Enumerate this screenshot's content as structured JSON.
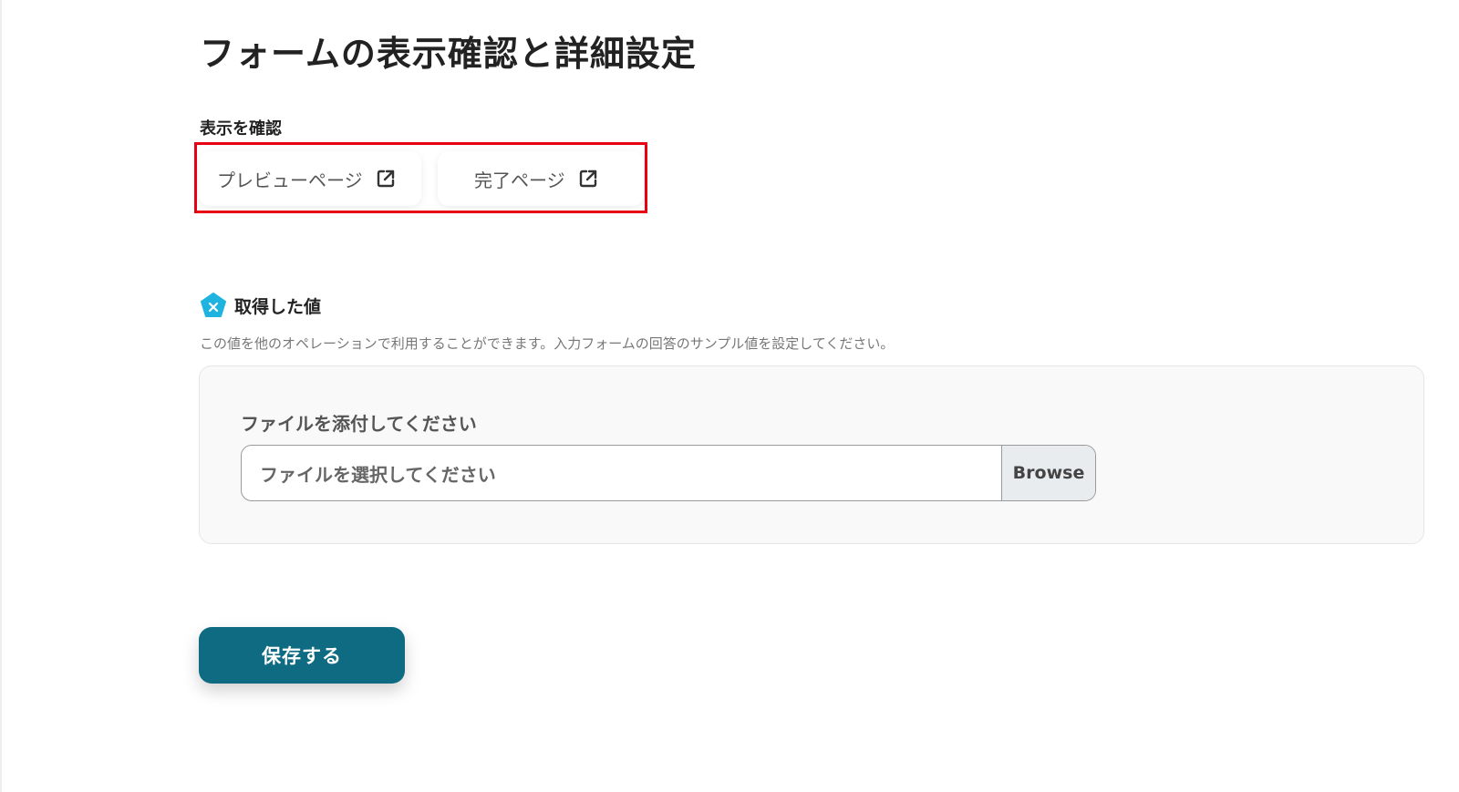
{
  "page": {
    "title": "フォームの表示確認と詳細設定"
  },
  "display_check": {
    "label": "表示を確認",
    "buttons": [
      {
        "label": "プレビューページ",
        "icon": "external-link-icon"
      },
      {
        "label": "完了ページ",
        "icon": "external-link-icon"
      }
    ],
    "highlight_color": "#e60012"
  },
  "values": {
    "title": "取得した値",
    "icon": "pentagon-x-icon",
    "icon_color": "#1fb3e0",
    "description": "この値を他のオペレーションで利用することができます。入力フォームの回答のサンプル値を設定してください。"
  },
  "file_field": {
    "label": "ファイルを添付してください",
    "placeholder": "ファイルを選択してください",
    "browse_label": "Browse"
  },
  "actions": {
    "save_label": "保存する",
    "save_color": "#0f6b82"
  }
}
